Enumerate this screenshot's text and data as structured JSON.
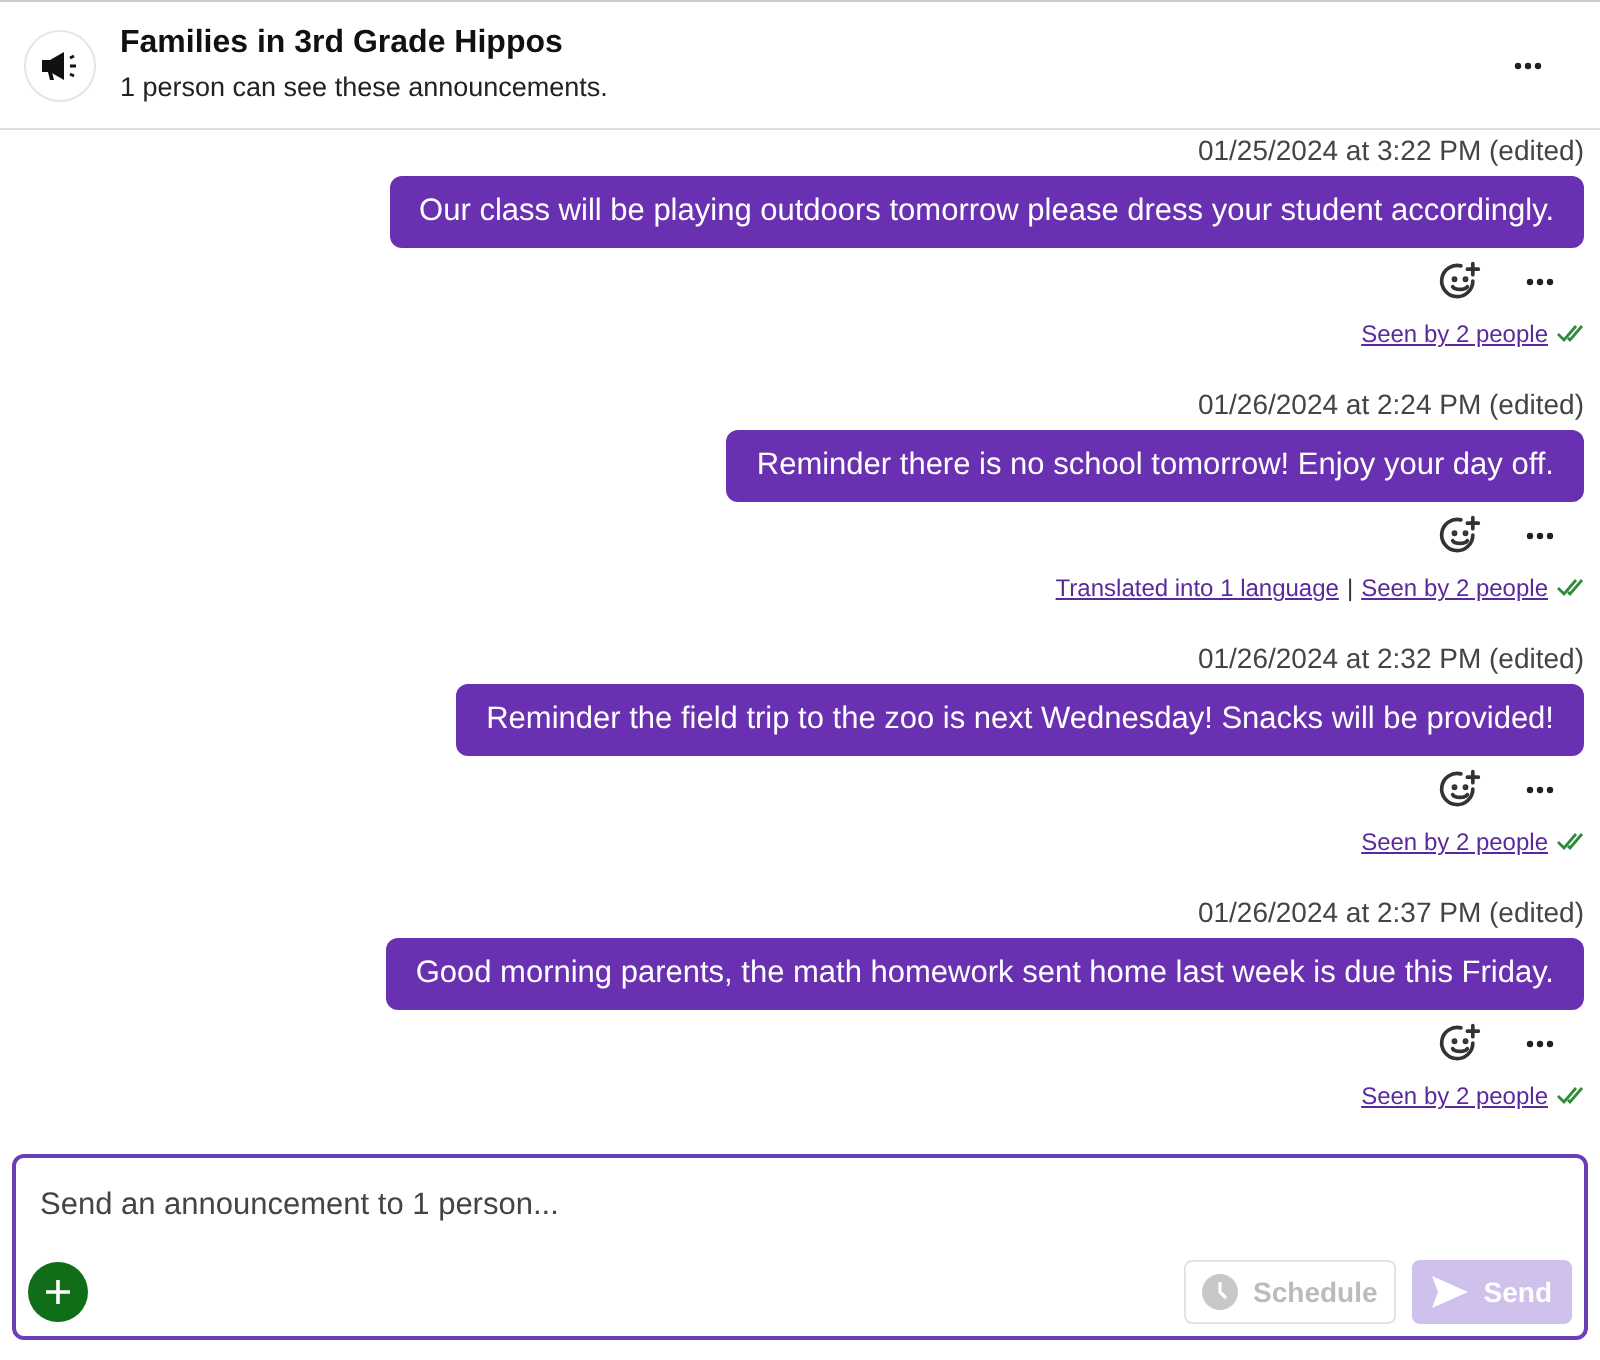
{
  "header": {
    "title": "Families in 3rd Grade Hippos",
    "subtitle": "1 person can see these announcements."
  },
  "messages": [
    {
      "timestamp": "01/25/2024 at 3:22 PM (edited)",
      "text": "Our class will be playing outdoors tomorrow please dress your student accordingly.",
      "links": [
        "Seen by 2 people"
      ],
      "seen": true
    },
    {
      "timestamp": "01/26/2024 at 2:24 PM (edited)",
      "text": "Reminder there is no school tomorrow! Enjoy your day off.",
      "links": [
        "Translated into 1 language",
        "Seen by 2 people"
      ],
      "separator": "|",
      "seen": true
    },
    {
      "timestamp": "01/26/2024 at 2:32 PM (edited)",
      "text": "Reminder the field trip to the zoo is next Wednesday! Snacks will be provided!",
      "links": [
        "Seen by 2 people"
      ],
      "seen": true
    },
    {
      "timestamp": "01/26/2024 at 2:37 PM (edited)",
      "text": "Good morning parents, the math homework sent home last week is due this Friday.",
      "links": [
        "Seen by 2 people"
      ],
      "seen": true
    }
  ],
  "composer": {
    "placeholder": "Send an announcement to 1 person...",
    "schedule": {
      "label": "Schedule",
      "disabled": true
    },
    "send": {
      "label": "Send",
      "disabled": true
    }
  }
}
